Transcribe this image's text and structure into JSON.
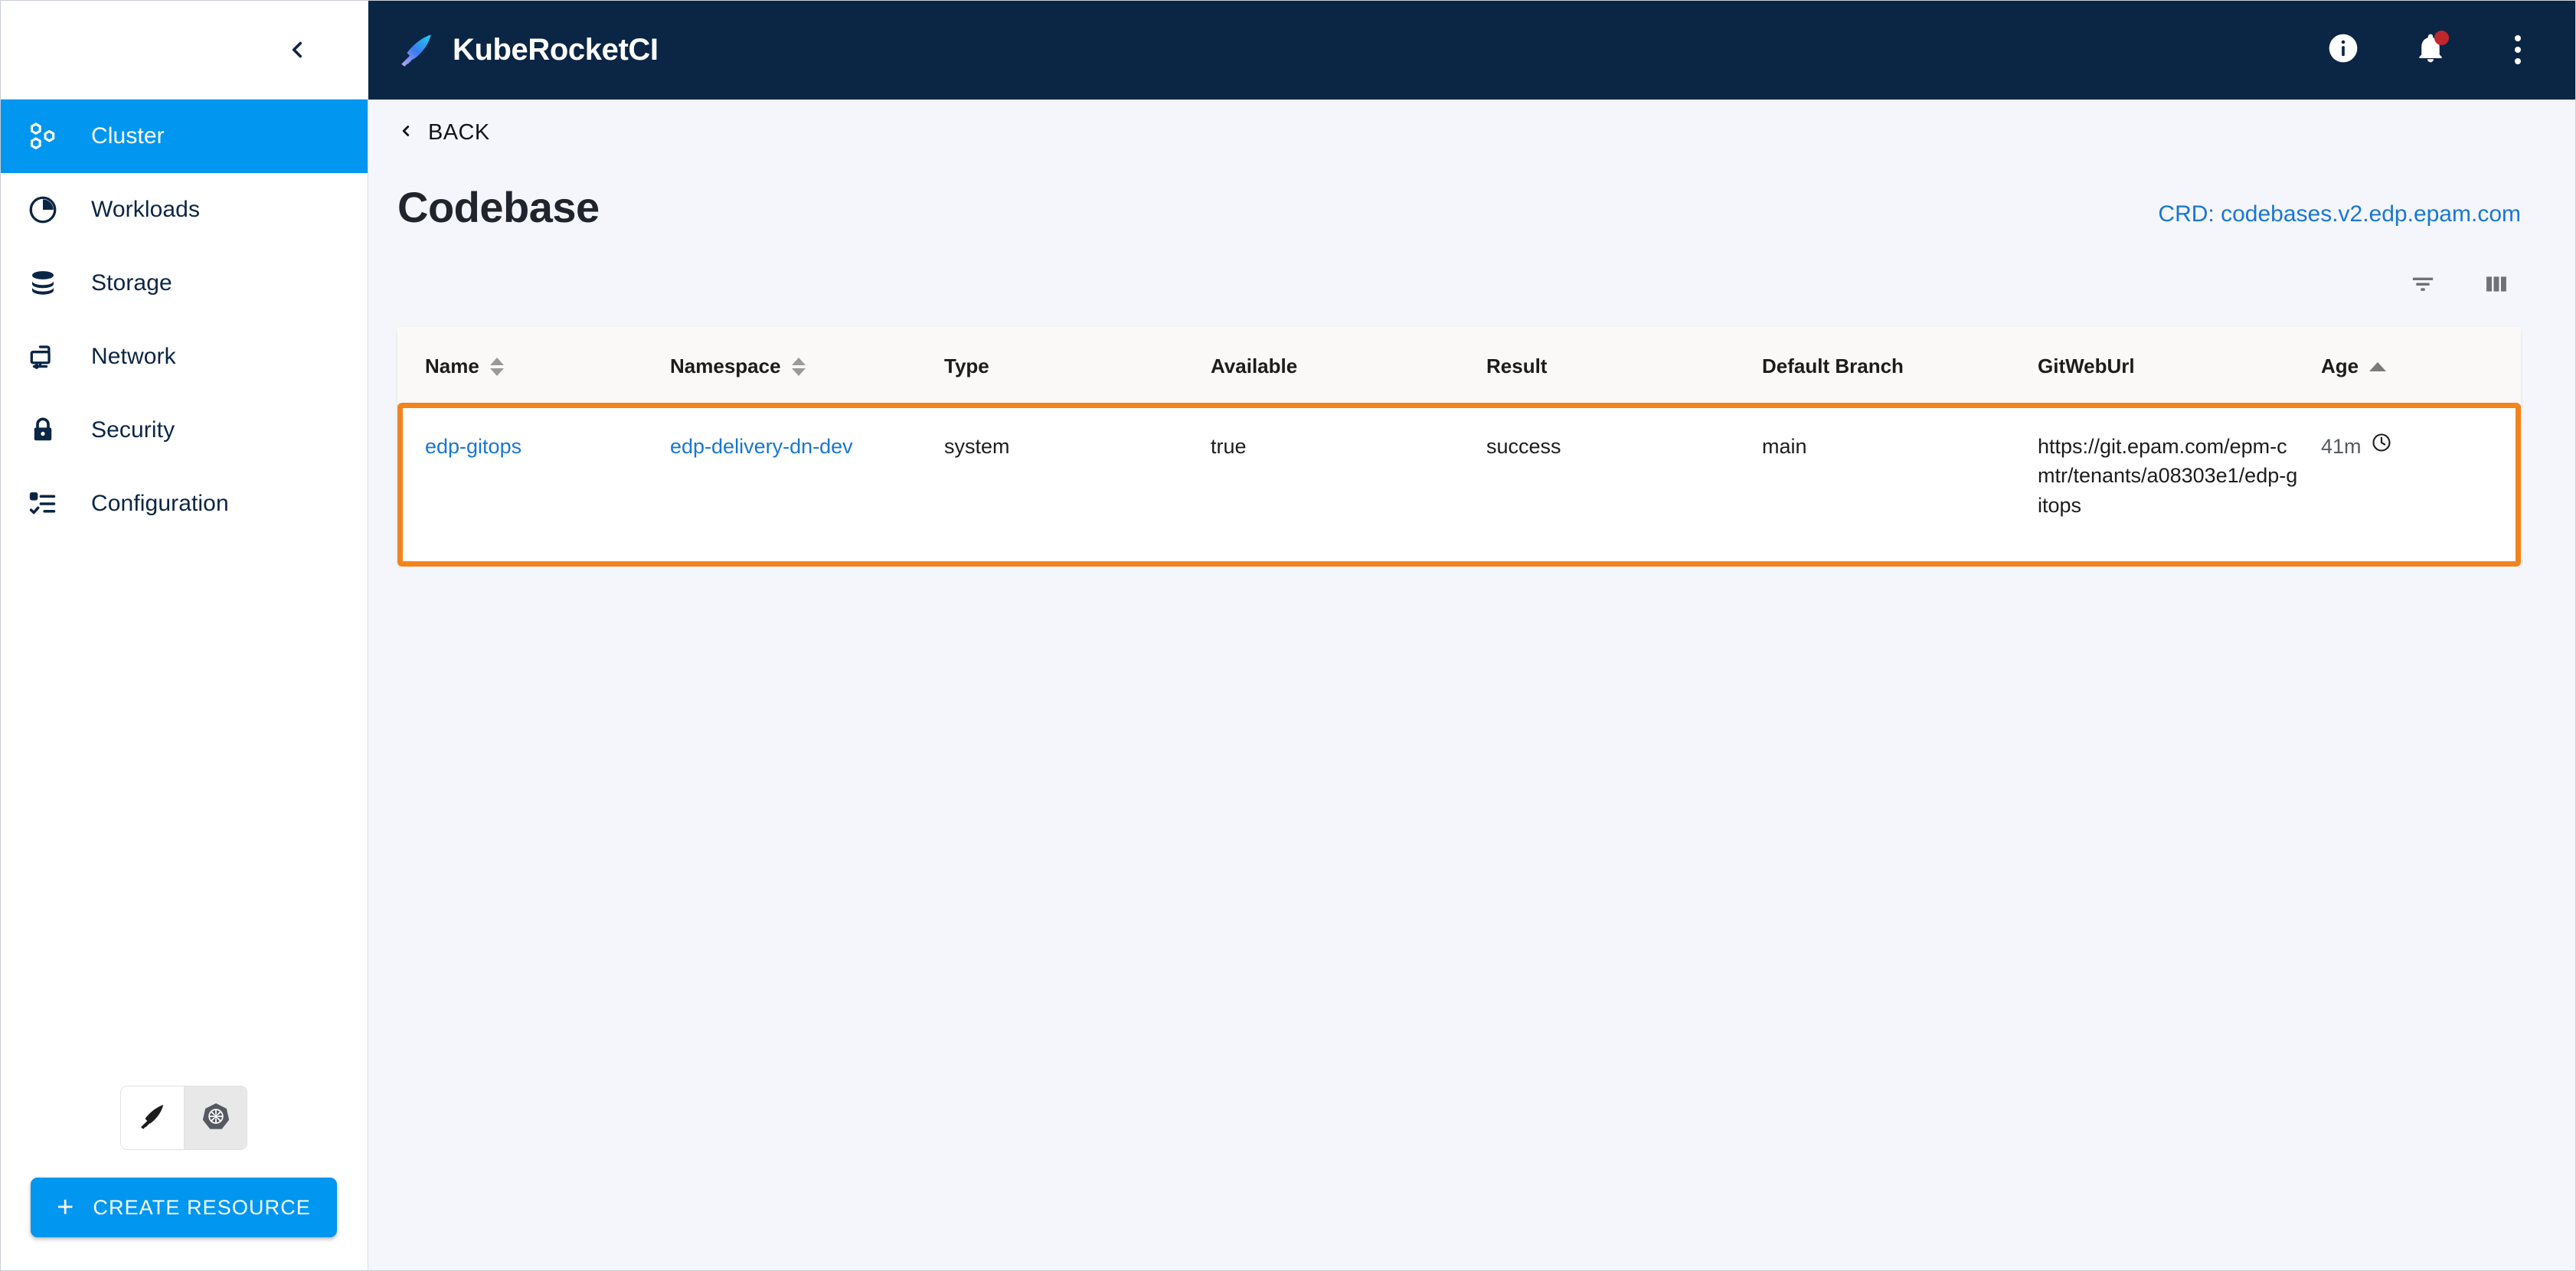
{
  "appbar": {
    "brand_title": "KubeRocketCI",
    "logo_icon": "rocket-feather-logo",
    "actions": [
      {
        "name": "info-icon",
        "label": "Information"
      },
      {
        "name": "bell-icon",
        "label": "Notifications",
        "has_badge": true
      },
      {
        "name": "kebab-menu-icon",
        "label": "More options"
      }
    ]
  },
  "sidebar": {
    "collapse_icon": "chevron-left-icon",
    "items": [
      {
        "label": "Cluster",
        "icon": "cluster-icon",
        "active": true
      },
      {
        "label": "Workloads",
        "icon": "workloads-pie-icon",
        "active": false
      },
      {
        "label": "Storage",
        "icon": "storage-db-icon",
        "active": false
      },
      {
        "label": "Network",
        "icon": "network-monitor-icon",
        "active": false
      },
      {
        "label": "Security",
        "icon": "lock-icon",
        "active": false
      },
      {
        "label": "Configuration",
        "icon": "checklist-icon",
        "active": false
      }
    ],
    "segmented": [
      {
        "name": "kuberocketci-view-toggle",
        "icon": "rocket-feather-icon",
        "selected": false
      },
      {
        "name": "kubernetes-view-toggle",
        "icon": "kubernetes-helm-icon",
        "selected": true
      }
    ],
    "create_button": {
      "label": "CREATE RESOURCE",
      "icon": "plus-icon"
    }
  },
  "main": {
    "back": {
      "label": "BACK",
      "icon": "chevron-left-icon"
    },
    "page_title": "Codebase",
    "crd_link": "CRD: codebases.v2.edp.epam.com",
    "tools": [
      {
        "name": "filter-icon",
        "label": "Filter"
      },
      {
        "name": "columns-icon",
        "label": "Columns"
      }
    ]
  },
  "table": {
    "columns": [
      {
        "key": "name",
        "label": "Name",
        "sortable": true,
        "sort": "none"
      },
      {
        "key": "namespace",
        "label": "Namespace",
        "sortable": true,
        "sort": "none"
      },
      {
        "key": "type",
        "label": "Type",
        "sortable": false,
        "sort": null
      },
      {
        "key": "available",
        "label": "Available",
        "sortable": false,
        "sort": null
      },
      {
        "key": "result",
        "label": "Result",
        "sortable": false,
        "sort": null
      },
      {
        "key": "branch",
        "label": "Default Branch",
        "sortable": false,
        "sort": null
      },
      {
        "key": "giturl",
        "label": "GitWebUrl",
        "sortable": false,
        "sort": null
      },
      {
        "key": "age",
        "label": "Age",
        "sortable": true,
        "sort": "asc"
      }
    ],
    "rows": [
      {
        "name": "edp-gitops",
        "namespace": "edp-delivery-dn-dev",
        "type": "system",
        "available": "true",
        "result": "success",
        "branch": "main",
        "giturl": "https://git.epam.com/epm-cmtr/tenants/a08303e1/edp-gitops",
        "age": "41m",
        "age_icon": "clock-icon",
        "highlighted": true
      }
    ]
  },
  "colors": {
    "accent_blue": "#0196f0",
    "appbar_navy": "#0b2545",
    "link_blue": "#1976d2",
    "highlight_orange": "#f2841e",
    "badge_red": "#c0272d",
    "page_bg": "#f4f6fb"
  }
}
